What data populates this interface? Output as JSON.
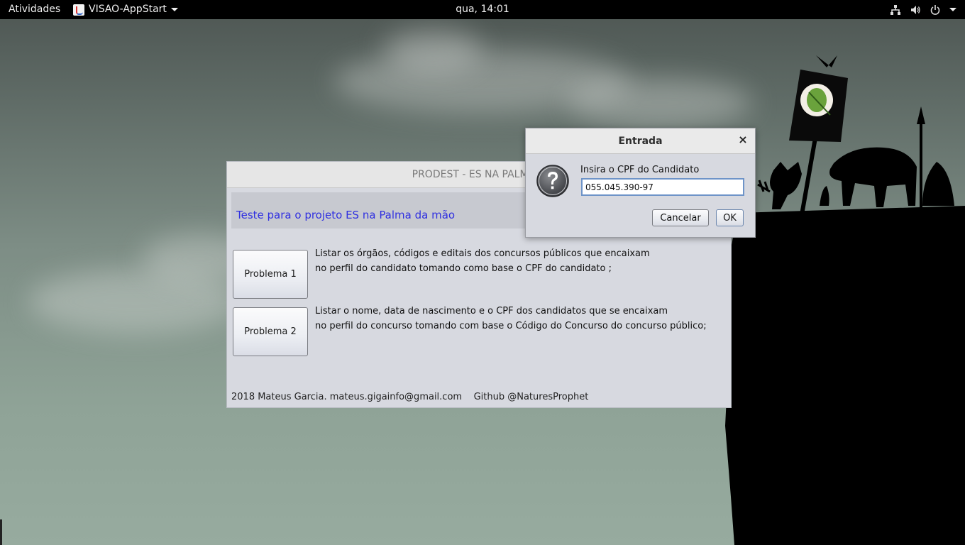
{
  "topbar": {
    "activities": "Atividades",
    "app_name": "VISAO-AppStart",
    "clock": "qua, 14:01",
    "tray_icons": [
      "network-icon",
      "volume-icon",
      "power-icon"
    ]
  },
  "main_window": {
    "title": "PRODEST - ES NA PALMA D",
    "header": "Teste para o projeto ES na Palma da mão",
    "problems": [
      {
        "label": "Problema 1",
        "description_line1": "Listar os órgãos, códigos e editais dos concursos públicos que encaixam",
        "description_line2": "no perfil do candidato tomando como base o CPF do candidato ;"
      },
      {
        "label": "Problema 2",
        "description_line1": "Listar o nome, data de nascimento e o CPF dos candidatos que se encaixam",
        "description_line2": "no perfil do concurso tomando com base o Código do Concurso do concurso público;"
      }
    ],
    "footer": "2018 Mateus Garcia. mateus.gigainfo@gmail.com    Github @NaturesProphet"
  },
  "dialog": {
    "title": "Entrada",
    "close_glyph": "×",
    "prompt": "Insira o CPF do Candidato",
    "input_value": "055.045.390-97",
    "cancel_label": "Cancelar",
    "ok_label": "OK"
  },
  "colors": {
    "header_text": "#3030e0",
    "topbar_bg": "#000000",
    "window_bg": "#d7d9e0"
  }
}
